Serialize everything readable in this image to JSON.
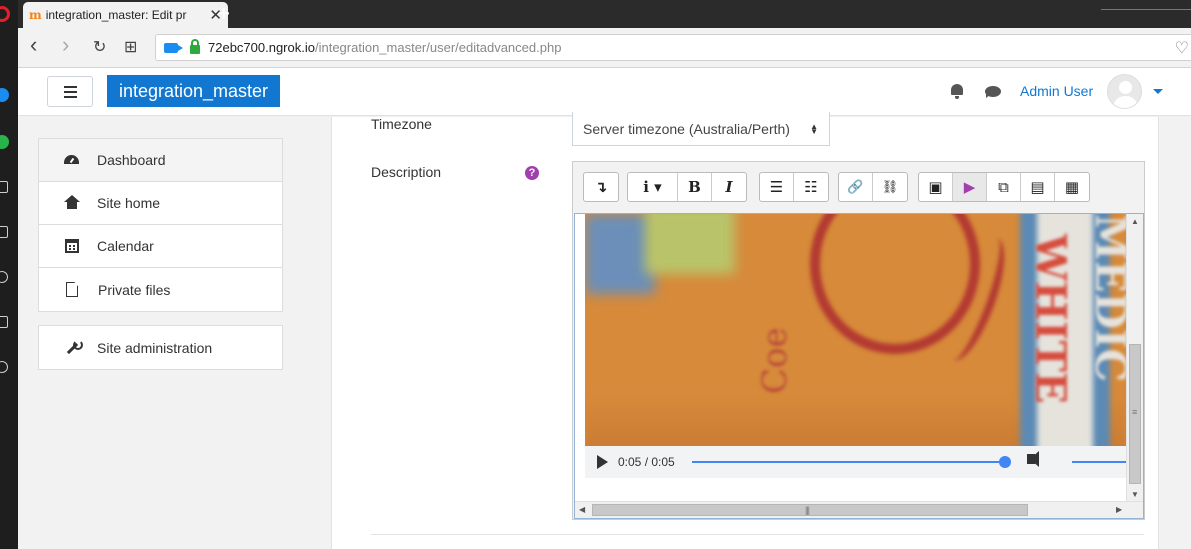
{
  "browser": {
    "tab_title": "integration_master: Edit pr",
    "tab_favicon": "m",
    "tab_close": "✕",
    "new_tab": "+",
    "url_host": "72ebc700.ngrok.io",
    "url_path": "/integration_master/user/editadvanced.php",
    "back": "‹",
    "forward": "›",
    "reload": "↻",
    "grid": "⊞",
    "heart": "♡"
  },
  "navbar": {
    "brand": "integration_master",
    "user_name": "Admin User"
  },
  "drawer": {
    "items": [
      {
        "label": "Dashboard"
      },
      {
        "label": "Site home"
      },
      {
        "label": "Calendar"
      },
      {
        "label": "Private files"
      }
    ],
    "admin_item": {
      "label": "Site administration"
    }
  },
  "form": {
    "timezone_label": "Timezone",
    "timezone_value": "Server timezone (Australia/Perth)",
    "description_label": "Description",
    "help_glyph": "?"
  },
  "toolbar": {
    "collapse": "↴",
    "info": "i ▾",
    "bold": "B",
    "italic": "I",
    "ul": "☰",
    "ol": "☷",
    "link": "🔗",
    "unlink": "⛓",
    "image": "▣",
    "media": "▶",
    "manage": "⧉",
    "file": "▤",
    "h5p": "▦"
  },
  "player": {
    "time": "0:05 / 0:05",
    "progress": 1.0
  },
  "video_text": {
    "coe": "Coe",
    "white": "WHITE",
    "medic": "MEDIC"
  },
  "colors": {
    "brand": "#1177d1",
    "help": "#a13fae",
    "media_active": "#a13fae"
  }
}
